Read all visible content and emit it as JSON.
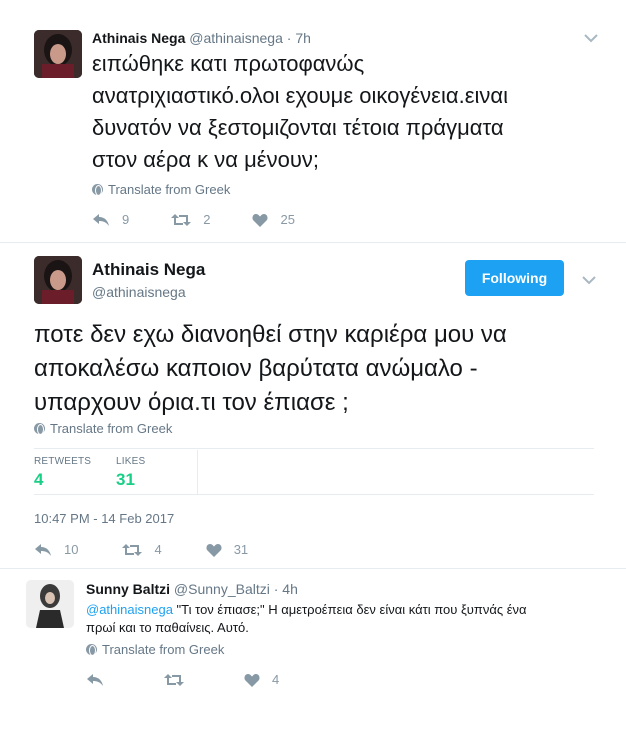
{
  "tweet1": {
    "name": "Athinais Nega",
    "handle": "@athinaisnega",
    "time": "· 7h",
    "text_lines": [
      "ειπώθηκε κατι πρωτοφανώς",
      "ανατριχιαστικό.ολοι εχουμε οικογένεια.ειναι",
      "δυνατόν να ξεστομιζονται τέτοια πράγματα",
      "στον αέρα κ να μένουν;"
    ],
    "translate": "Translate from Greek",
    "replies": "9",
    "retweets": "2",
    "likes": "25"
  },
  "tweet2": {
    "name": "Athinais Nega",
    "handle": "@athinaisnega",
    "follow_label": "Following",
    "text_lines": [
      "ποτε δεν εχω διανοηθεί στην καριέρα μου να",
      "αποκαλέσω καποιον  βαρύτατα ανώμαλο -",
      "υπαρχουν όρια.τι τον έπιασε ;"
    ],
    "translate": "Translate from Greek",
    "stats": {
      "retweets_label": "RETWEETS",
      "retweets_value": "4",
      "likes_label": "LIKES",
      "likes_value": "31"
    },
    "timestamp": "10:47 PM - 14 Feb 2017",
    "replies": "10",
    "retweets": "4",
    "likes": "31"
  },
  "reply": {
    "name": "Sunny Baltzi",
    "handle": "@Sunny_Baltzi",
    "time": "· 4h",
    "mention": "@athinaisnega",
    "text_line1": " \"Τι τον έπιασε;\" Η αμετροέπεια δεν είναι κάτι που ξυπνάς ένα",
    "text_line2": "πρωί και το παθαίνεις. Αυτό.",
    "translate": "Translate from Greek",
    "likes": "4"
  },
  "colors": {
    "accent": "#1da1f2",
    "stat_green": "#19cf86",
    "muted": "#657786",
    "icon": "#8899a6"
  }
}
